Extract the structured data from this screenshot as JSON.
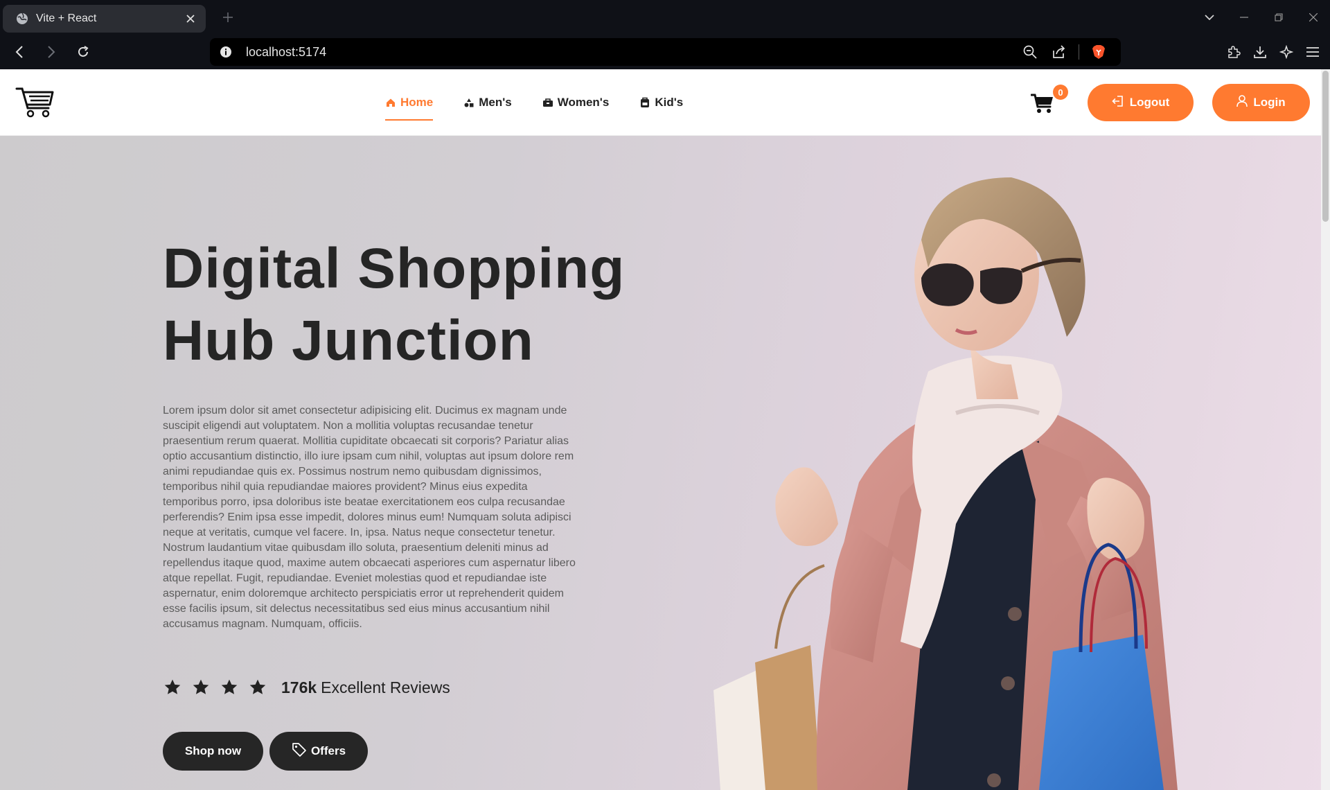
{
  "browser": {
    "tab_title": "Vite + React",
    "url": "localhost:5174"
  },
  "site": {
    "nav": [
      {
        "label": "Home",
        "icon": "home-icon",
        "active": true
      },
      {
        "label": "Men's",
        "icon": "shapes-icon",
        "active": false
      },
      {
        "label": "Women's",
        "icon": "handbag-icon",
        "active": false
      },
      {
        "label": "Kid's",
        "icon": "kid-bag-icon",
        "active": false
      }
    ],
    "cart_count": "0",
    "logout_label": "Logout",
    "login_label": "Login"
  },
  "hero": {
    "title_line1": "Digital Shopping",
    "title_line2": "Hub Junction",
    "description": "Lorem ipsum dolor sit amet consectetur adipisicing elit. Ducimus ex magnam unde suscipit eligendi aut voluptatem. Non a mollitia voluptas recusandae tenetur praesentium rerum quaerat. Mollitia cupiditate obcaecati sit corporis? Pariatur alias optio accusantium distinctio, illo iure ipsam cum nihil, voluptas aut ipsum dolore rem animi repudiandae quis ex. Possimus nostrum nemo quibusdam dignissimos, temporibus nihil quia repudiandae maiores provident? Minus eius expedita temporibus porro, ipsa doloribus iste beatae exercitationem eos culpa recusandae perferendis? Enim ipsa esse impedit, dolores minus eum! Numquam soluta adipisci neque at veritatis, cumque vel facere. In, ipsa. Natus neque consectetur tenetur. Nostrum laudantium vitae quibusdam illo soluta, praesentium deleniti minus ad repellendus itaque quod, maxime autem obcaecati asperiores cum aspernatur libero atque repellat. Fugit, repudiandae. Eveniet molestias quod et repudiandae iste aspernatur, enim doloremque architecto perspiciatis error ut reprehenderit quidem esse facilis ipsum, sit delectus necessitatibus sed eius minus accusantium nihil accusamus magnam. Numquam, officiis.",
    "rating_stars": 4,
    "reviews_count": "176k",
    "reviews_text": "Excellent Reviews",
    "shop_label": "Shop now",
    "offers_label": "Offers"
  },
  "colors": {
    "accent": "#ff7a30",
    "dark_button": "#262626",
    "heading": "#252525"
  }
}
